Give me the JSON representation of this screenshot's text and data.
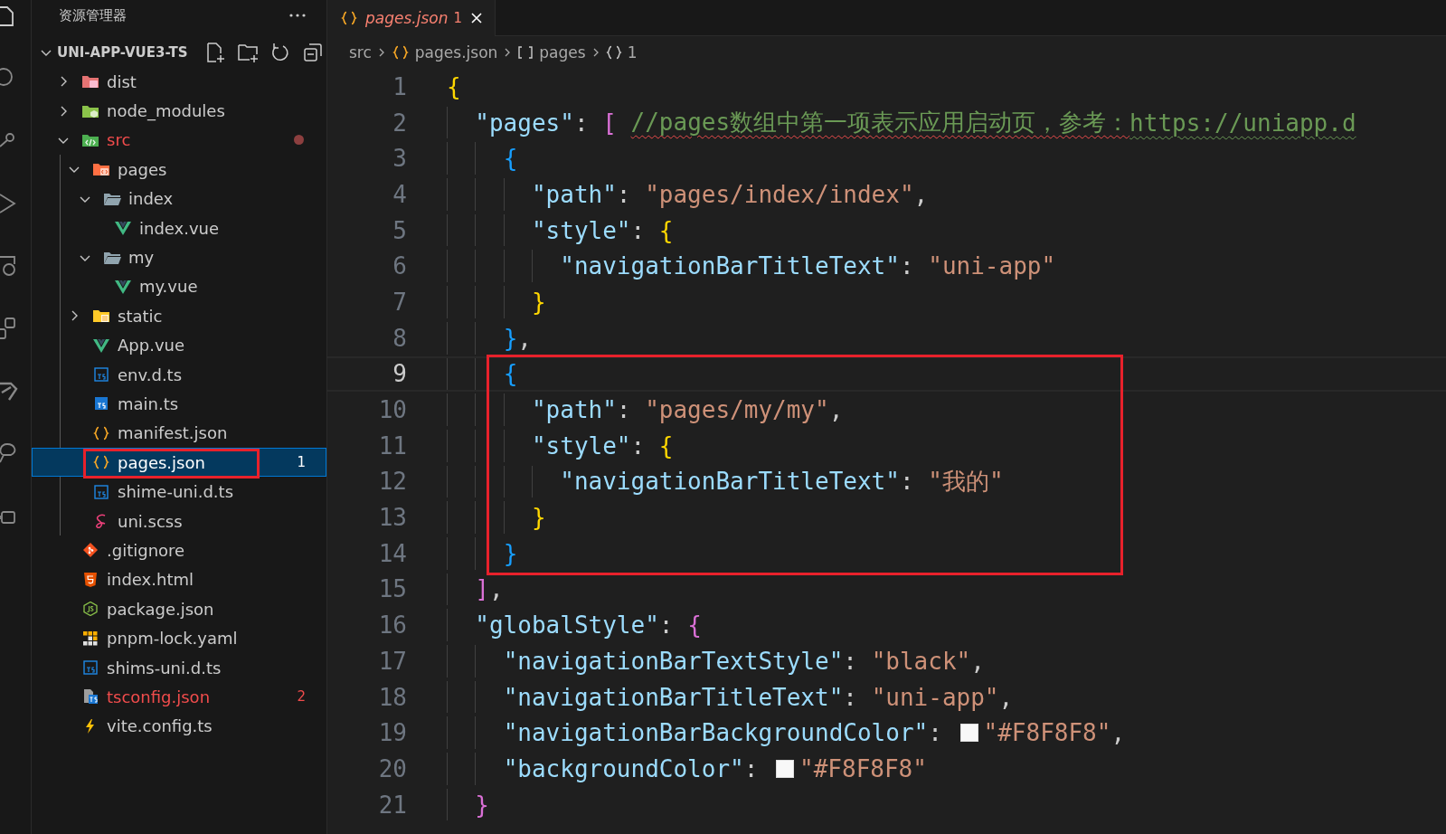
{
  "sidebar": {
    "title": "资源管理器",
    "root": {
      "label": "UNI-APP-VUE3-TS",
      "expanded": true,
      "children": [
        {
          "label": "dist",
          "kind": "folder-dist",
          "expanded": false,
          "selected": false,
          "errors": false,
          "boxed": false
        },
        {
          "label": "node_modules",
          "kind": "folder-node",
          "expanded": false,
          "selected": false,
          "errors": false,
          "boxed": false
        },
        {
          "label": "src",
          "kind": "folder-src",
          "expanded": true,
          "selected": false,
          "errors": true,
          "boxed": false,
          "dot": true,
          "children": [
            {
              "label": "pages",
              "kind": "folder-pages",
              "expanded": true,
              "selected": false,
              "errors": false,
              "boxed": false,
              "children": [
                {
                  "label": "index",
                  "kind": "folder",
                  "expanded": true,
                  "selected": false,
                  "errors": false,
                  "boxed": false,
                  "children": [
                    {
                      "label": "index.vue",
                      "kind": "vue",
                      "selected": false,
                      "errors": false,
                      "boxed": false
                    }
                  ]
                },
                {
                  "label": "my",
                  "kind": "folder",
                  "expanded": true,
                  "selected": false,
                  "errors": false,
                  "boxed": false,
                  "children": [
                    {
                      "label": "my.vue",
                      "kind": "vue",
                      "selected": false,
                      "errors": false,
                      "boxed": false
                    }
                  ]
                }
              ]
            },
            {
              "label": "static",
              "kind": "folder-static",
              "expanded": false,
              "selected": false,
              "errors": false,
              "boxed": false
            },
            {
              "label": "App.vue",
              "kind": "vue",
              "selected": false,
              "errors": false,
              "boxed": false
            },
            {
              "label": "env.d.ts",
              "kind": "ts",
              "selected": false,
              "errors": false,
              "boxed": false
            },
            {
              "label": "main.ts",
              "kind": "ts-solid",
              "selected": false,
              "errors": false,
              "boxed": false
            },
            {
              "label": "manifest.json",
              "kind": "json",
              "selected": false,
              "errors": false,
              "boxed": false
            },
            {
              "label": "pages.json",
              "kind": "json",
              "selected": true,
              "errors": false,
              "boxed": true,
              "badge": "1"
            },
            {
              "label": "shime-uni.d.ts",
              "kind": "ts",
              "selected": false,
              "errors": false,
              "boxed": false
            },
            {
              "label": "uni.scss",
              "kind": "sass",
              "selected": false,
              "errors": false,
              "boxed": false
            }
          ]
        },
        {
          "label": ".gitignore",
          "kind": "git",
          "selected": false,
          "errors": false,
          "boxed": false
        },
        {
          "label": "index.html",
          "kind": "html",
          "selected": false,
          "errors": false,
          "boxed": false
        },
        {
          "label": "package.json",
          "kind": "nodejs",
          "selected": false,
          "errors": false,
          "boxed": false
        },
        {
          "label": "pnpm-lock.yaml",
          "kind": "pnpm",
          "selected": false,
          "errors": false,
          "boxed": false
        },
        {
          "label": "shims-uni.d.ts",
          "kind": "ts",
          "selected": false,
          "errors": false,
          "boxed": false
        },
        {
          "label": "tsconfig.json",
          "kind": "tsconfig",
          "selected": false,
          "errors": true,
          "boxed": false,
          "badge": "2"
        },
        {
          "label": "vite.config.ts",
          "kind": "vite",
          "selected": false,
          "errors": false,
          "boxed": false
        }
      ]
    }
  },
  "tabs": [
    {
      "label": "pages.json",
      "badge": "1",
      "selected": true,
      "preview": true,
      "errors": true
    }
  ],
  "breadcrumbs": [
    {
      "label": "src",
      "kind": "folder"
    },
    {
      "label": "pages.json",
      "kind": "json"
    },
    {
      "label": "pages",
      "kind": "array"
    },
    {
      "label": "1",
      "kind": "object"
    }
  ],
  "editor": {
    "lines": [
      {
        "number": "1",
        "current": false,
        "boxed": false,
        "tokens": [
          {
            "kind": "bracket1",
            "text": "{"
          }
        ]
      },
      {
        "number": "2",
        "current": false,
        "boxed": false,
        "tokens": [
          {
            "kind": "key",
            "text": "  \"pages\""
          },
          {
            "kind": "punct",
            "text": ": "
          },
          {
            "kind": "bracket2",
            "text": "[ "
          },
          {
            "kind": "comment",
            "text": "//pages数组中第一项表示应用启动页，参考："
          },
          {
            "kind": "link",
            "text": "https://uniapp.d"
          }
        ]
      },
      {
        "number": "3",
        "current": false,
        "boxed": false,
        "tokens": [
          {
            "kind": "bracket3",
            "text": "    {"
          }
        ]
      },
      {
        "number": "4",
        "current": false,
        "boxed": false,
        "tokens": [
          {
            "kind": "key",
            "text": "      \"path\""
          },
          {
            "kind": "punct",
            "text": ": "
          },
          {
            "kind": "string",
            "text": "\"pages/index/index\""
          },
          {
            "kind": "punct",
            "text": ","
          }
        ]
      },
      {
        "number": "5",
        "current": false,
        "boxed": false,
        "tokens": [
          {
            "kind": "key",
            "text": "      \"style\""
          },
          {
            "kind": "punct",
            "text": ": "
          },
          {
            "kind": "bracket1",
            "text": "{"
          }
        ]
      },
      {
        "number": "6",
        "current": false,
        "boxed": false,
        "tokens": [
          {
            "kind": "key",
            "text": "        \"navigationBarTitleText\""
          },
          {
            "kind": "punct",
            "text": ": "
          },
          {
            "kind": "string",
            "text": "\"uni-app\""
          }
        ]
      },
      {
        "number": "7",
        "current": false,
        "boxed": false,
        "tokens": [
          {
            "kind": "bracket1",
            "text": "      }"
          }
        ]
      },
      {
        "number": "8",
        "current": false,
        "boxed": false,
        "tokens": [
          {
            "kind": "bracket3",
            "text": "    }"
          },
          {
            "kind": "punct",
            "text": ","
          }
        ]
      },
      {
        "number": "9",
        "current": true,
        "boxed": true,
        "tokens": [
          {
            "kind": "bracket3",
            "text": "    {"
          }
        ]
      },
      {
        "number": "10",
        "current": false,
        "boxed": true,
        "tokens": [
          {
            "kind": "key",
            "text": "      \"path\""
          },
          {
            "kind": "punct",
            "text": ": "
          },
          {
            "kind": "string",
            "text": "\"pages/my/my\""
          },
          {
            "kind": "punct",
            "text": ","
          }
        ]
      },
      {
        "number": "11",
        "current": false,
        "boxed": true,
        "tokens": [
          {
            "kind": "key",
            "text": "      \"style\""
          },
          {
            "kind": "punct",
            "text": ": "
          },
          {
            "kind": "bracket1",
            "text": "{"
          }
        ]
      },
      {
        "number": "12",
        "current": false,
        "boxed": true,
        "tokens": [
          {
            "kind": "key",
            "text": "        \"navigationBarTitleText\""
          },
          {
            "kind": "punct",
            "text": ": "
          },
          {
            "kind": "string",
            "text": "\"我的\""
          }
        ]
      },
      {
        "number": "13",
        "current": false,
        "boxed": true,
        "tokens": [
          {
            "kind": "bracket1",
            "text": "      }"
          }
        ]
      },
      {
        "number": "14",
        "current": false,
        "boxed": true,
        "tokens": [
          {
            "kind": "bracket3",
            "text": "    }"
          }
        ]
      },
      {
        "number": "15",
        "current": false,
        "boxed": false,
        "tokens": [
          {
            "kind": "bracket2",
            "text": "  ]"
          },
          {
            "kind": "punct",
            "text": ","
          }
        ]
      },
      {
        "number": "16",
        "current": false,
        "boxed": false,
        "tokens": [
          {
            "kind": "key",
            "text": "  \"globalStyle\""
          },
          {
            "kind": "punct",
            "text": ": "
          },
          {
            "kind": "bracket2",
            "text": "{"
          }
        ]
      },
      {
        "number": "17",
        "current": false,
        "boxed": false,
        "tokens": [
          {
            "kind": "key",
            "text": "    \"navigationBarTextStyle\""
          },
          {
            "kind": "punct",
            "text": ": "
          },
          {
            "kind": "string",
            "text": "\"black\""
          },
          {
            "kind": "punct",
            "text": ","
          }
        ]
      },
      {
        "number": "18",
        "current": false,
        "boxed": false,
        "tokens": [
          {
            "kind": "key",
            "text": "    \"navigationBarTitleText\""
          },
          {
            "kind": "punct",
            "text": ": "
          },
          {
            "kind": "string",
            "text": "\"uni-app\""
          },
          {
            "kind": "punct",
            "text": ","
          }
        ]
      },
      {
        "number": "19",
        "current": false,
        "boxed": false,
        "tokens": [
          {
            "kind": "key",
            "text": "    \"navigationBarBackgroundColor\""
          },
          {
            "kind": "punct",
            "text": ": "
          },
          {
            "kind": "swatch",
            "color": "#f8f8f8"
          },
          {
            "kind": "string",
            "text": "\"#F8F8F8\""
          },
          {
            "kind": "punct",
            "text": ","
          }
        ]
      },
      {
        "number": "20",
        "current": false,
        "boxed": false,
        "tokens": [
          {
            "kind": "key",
            "text": "    \"backgroundColor\""
          },
          {
            "kind": "punct",
            "text": ": "
          },
          {
            "kind": "swatch",
            "color": "#f8f8f8"
          },
          {
            "kind": "string",
            "text": "\"#F8F8F8\""
          }
        ]
      },
      {
        "number": "21",
        "current": false,
        "boxed": false,
        "tokens": [
          {
            "kind": "bracket2",
            "text": "  }"
          }
        ]
      }
    ]
  }
}
